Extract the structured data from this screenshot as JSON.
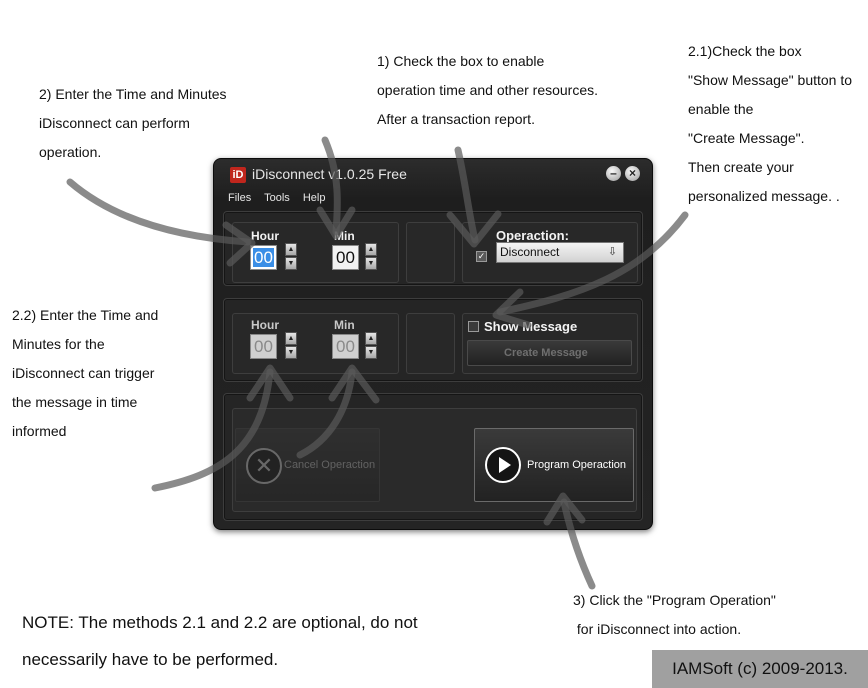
{
  "annotations": {
    "step1": [
      "1) Check the box to enable",
      "operation time and other resources.",
      "After a transaction report."
    ],
    "step21": [
      "2.1)Check the box",
      "\"Show Message\" button to",
      "enable the",
      "\"Create Message\".",
      "Then create your",
      "personalized message. ."
    ],
    "step2": [
      "2) Enter the Time and Minutes",
      "iDisconnect can perform",
      "operation."
    ],
    "step22": [
      "2.2) Enter the Time and",
      "Minutes for the",
      "iDisconnect can trigger",
      "the message in time",
      "informed"
    ],
    "step3": [
      "3) Click the \"Program Operation\"",
      " for iDisconnect into action."
    ],
    "note": [
      "NOTE: The methods 2.1 and 2.2 are optional, do not",
      "necessarily have to be performed."
    ],
    "copyright": "IAMSoft (c) 2009-2013."
  },
  "window": {
    "title": "iDisconnect v1.0.25 Free",
    "logo": "iD",
    "minimize": "–",
    "close": "×"
  },
  "menu": {
    "files": "Files",
    "tools": "Tools",
    "help": "Help"
  },
  "operation_panel": {
    "hour_label": "Hour",
    "hour_value": "00",
    "min_label": "Min",
    "min_value": "00",
    "enabled_checked": true,
    "operation_label": "Operaction:",
    "operation_selected": "Disconnect"
  },
  "message_panel": {
    "hour_label": "Hour",
    "hour_value": "00",
    "min_label": "Min",
    "min_value": "00",
    "show_message_label": "Show Message",
    "show_message_checked": false,
    "create_message_label": "Create Message"
  },
  "actions": {
    "cancel_label": "Cancel Operaction",
    "program_label": "Program Operaction"
  },
  "icons": {
    "cancel": "x-circle-icon",
    "program": "play-circle-icon"
  }
}
